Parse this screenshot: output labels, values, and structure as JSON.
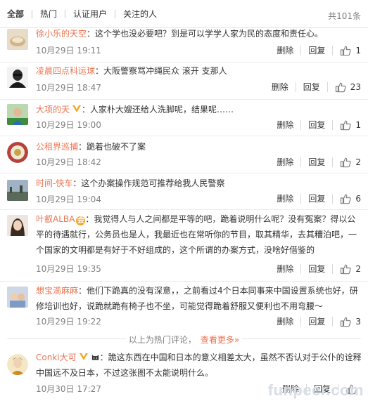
{
  "tabs": [
    {
      "label": "全部"
    },
    {
      "label": "热门"
    },
    {
      "label": "认证用户"
    },
    {
      "label": "关注的人"
    }
  ],
  "total_count": "共101条",
  "actions": {
    "delete": "删除",
    "reply": "回复"
  },
  "comments": [
    {
      "user": "徐小乐的天空",
      "text": "：这个学也没必要吧？到是可以学学人家为民的态度和责任心。",
      "time": "10月29日 19:11",
      "likes": "1"
    },
    {
      "user": "凌晨四点科运球",
      "text": "：大阪警察骂冲绳民众 滚开 支那人",
      "time": "10月29日 18:47",
      "likes": "23"
    },
    {
      "user": "大项的天",
      "text": "：人家朴大嫂还给人洗脚呢，结果呢……",
      "time": "10月29日 19:00",
      "likes": "1"
    },
    {
      "user": "公租界巡捕",
      "text": "：跪着也破不了案",
      "time": "10月29日 18:42",
      "likes": "2"
    },
    {
      "user": "时间-快车",
      "text": "：这个办案操作规范可推荐给我人民警察",
      "time": "10月29日 19:04",
      "likes": "6"
    },
    {
      "user": "叶叡ALBA",
      "text": "：我觉得人与人之间都是平等的吧，跪着说明什么呢？没有冤案？得以公平的待遇就行，公务员也是人，我最近也在常听你的节目，取其精华，去其糟泊吧，一个国家的文明都是有好于不好组成的，这个所谓的办案方式，没啥好借鉴的",
      "time": "10月29日 19:35",
      "likes": "2"
    },
    {
      "user": "想宝滴麻麻",
      "text": "：他们下跪真的没有深意，，之前看过4个日本同事来中国设置系统也好，研修培训也好，说跪就跪有椅子也不坐，可能觉得跪着舒服又便利也不用弯腰～",
      "time": "10月29日 19:22",
      "likes": "3"
    },
    {
      "user": "Conki大可",
      "text": "：跪这东西在中国和日本的意义相差太大，虽然不否认对于公仆的诠释中国远不及日本，不过这张图不太能说明什么。",
      "time": "10月30日 17:27",
      "likes": ""
    }
  ],
  "hot_end": {
    "text": "以上为热门评论，",
    "more": "查看更多»"
  },
  "watermark": "funpeer.com",
  "colors": {
    "username": "#eb7350",
    "muted": "#808080",
    "badge": "#f5a623"
  }
}
